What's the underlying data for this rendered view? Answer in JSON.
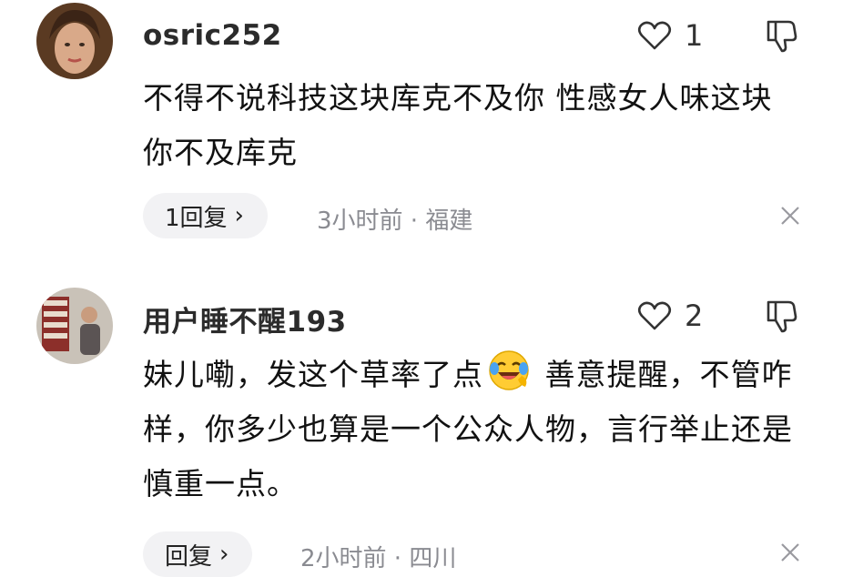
{
  "comments": [
    {
      "username": "osric252",
      "text": "不得不说科技这块库克不及你 性感女人味这块你不及库克",
      "likes": "1",
      "reply_label": "1回复",
      "meta": "3小时前 · 福建",
      "avatar_icon": "user-avatar",
      "like_icon": "heart-outline-icon",
      "dislike_icon": "thumbs-down-icon",
      "close_icon": "close-icon"
    },
    {
      "username": "用户睡不醒193",
      "text_before_emoji": "妹儿嘞，发这个草率了点",
      "emoji": "laughing-crying-emoji",
      "text_after_emoji": " 善意提醒，不管咋样，你多少也算是一个公众人物，言行举止还是慎重一点。",
      "likes": "2",
      "reply_label": "回复",
      "meta": "2小时前 · 四川",
      "avatar_icon": "user-avatar",
      "like_icon": "heart-outline-icon",
      "dislike_icon": "thumbs-down-icon",
      "close_icon": "close-icon"
    }
  ],
  "colors": {
    "text": "#111111",
    "meta": "#8a8b91",
    "reply_bg": "#f2f2f4"
  }
}
